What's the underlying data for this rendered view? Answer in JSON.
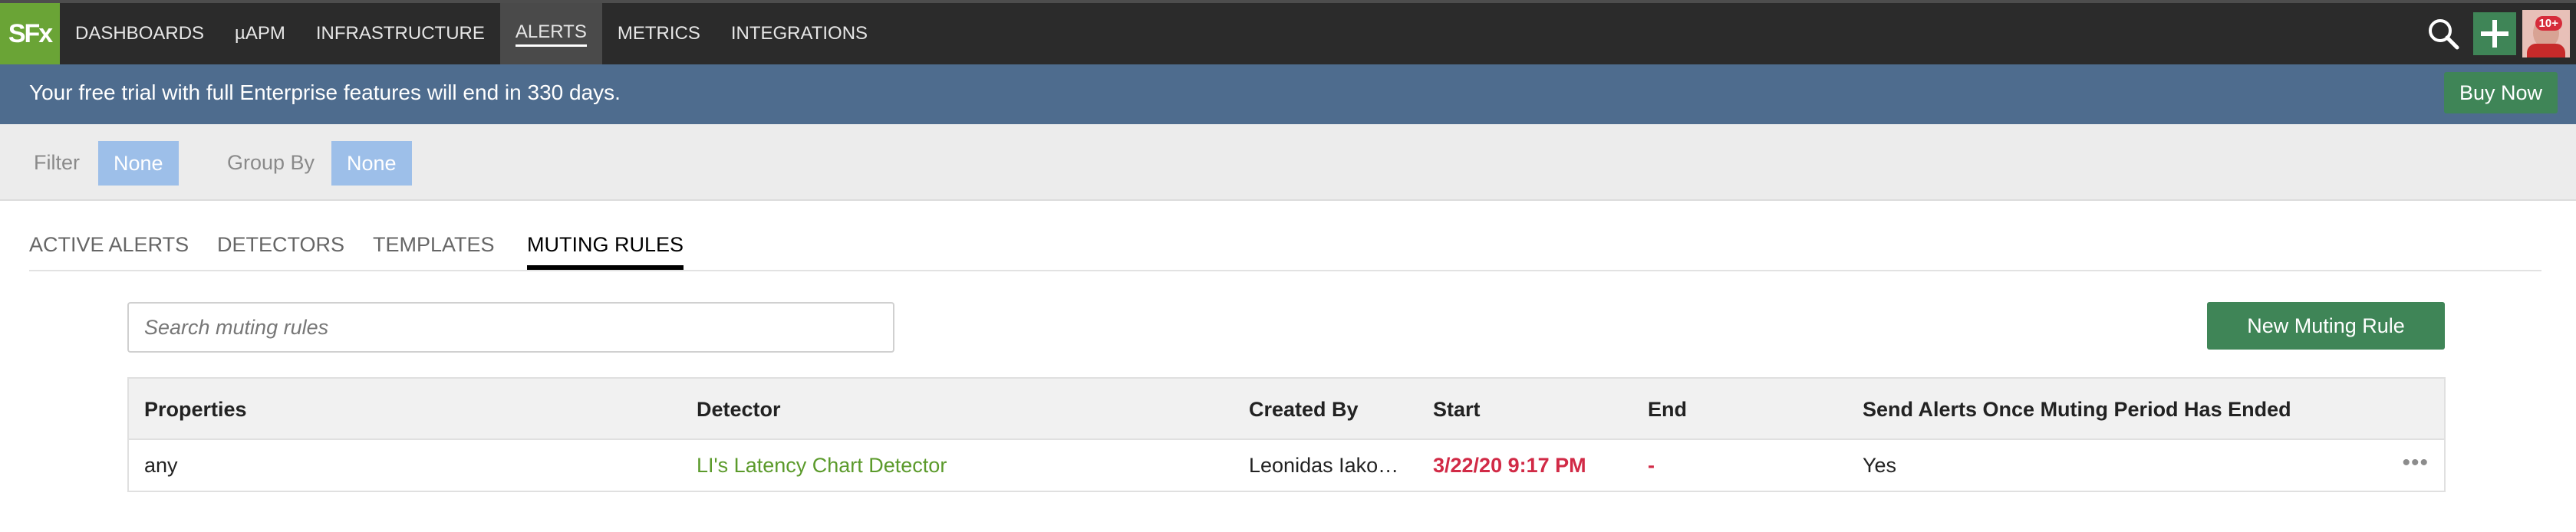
{
  "app": {
    "logo": "SFx"
  },
  "nav": {
    "items": [
      {
        "label": "DASHBOARDS"
      },
      {
        "label": "µAPM"
      },
      {
        "label": "INFRASTRUCTURE"
      },
      {
        "label": "ALERTS"
      },
      {
        "label": "METRICS"
      },
      {
        "label": "INTEGRATIONS"
      }
    ],
    "active": "ALERTS",
    "notification_badge": "10+"
  },
  "banner": {
    "text": "Your free trial with full Enterprise features will end in 330 days.",
    "buy_label": "Buy Now"
  },
  "filters": {
    "filter_label": "Filter",
    "filter_value": "None",
    "group_by_label": "Group By",
    "group_by_value": "None"
  },
  "tabs": [
    {
      "label": "ACTIVE ALERTS"
    },
    {
      "label": "DETECTORS"
    },
    {
      "label": "TEMPLATES"
    },
    {
      "label": "MUTING RULES"
    }
  ],
  "active_tab": "MUTING RULES",
  "search": {
    "placeholder": "Search muting rules"
  },
  "new_rule_label": "New Muting Rule",
  "table": {
    "headers": {
      "properties": "Properties",
      "detector": "Detector",
      "created_by": "Created By",
      "start": "Start",
      "end": "End",
      "send_alerts": "Send Alerts Once Muting Period Has Ended"
    },
    "rows": [
      {
        "properties": "any",
        "detector": "LI's Latency Chart Detector",
        "created_by": "Leonidas Iako…",
        "start": "3/22/20 9:17 PM",
        "end": "-",
        "send_alerts": "Yes"
      }
    ]
  },
  "colors": {
    "accent_green": "#3f8557",
    "logo_green": "#6aa436",
    "banner_blue": "#4e6c8e",
    "pill_blue": "#9dbfe9",
    "link_green": "#5b9a2b",
    "alert_red": "#d12a46"
  },
  "icons": [
    "search-icon",
    "plus-icon",
    "more-icon"
  ]
}
